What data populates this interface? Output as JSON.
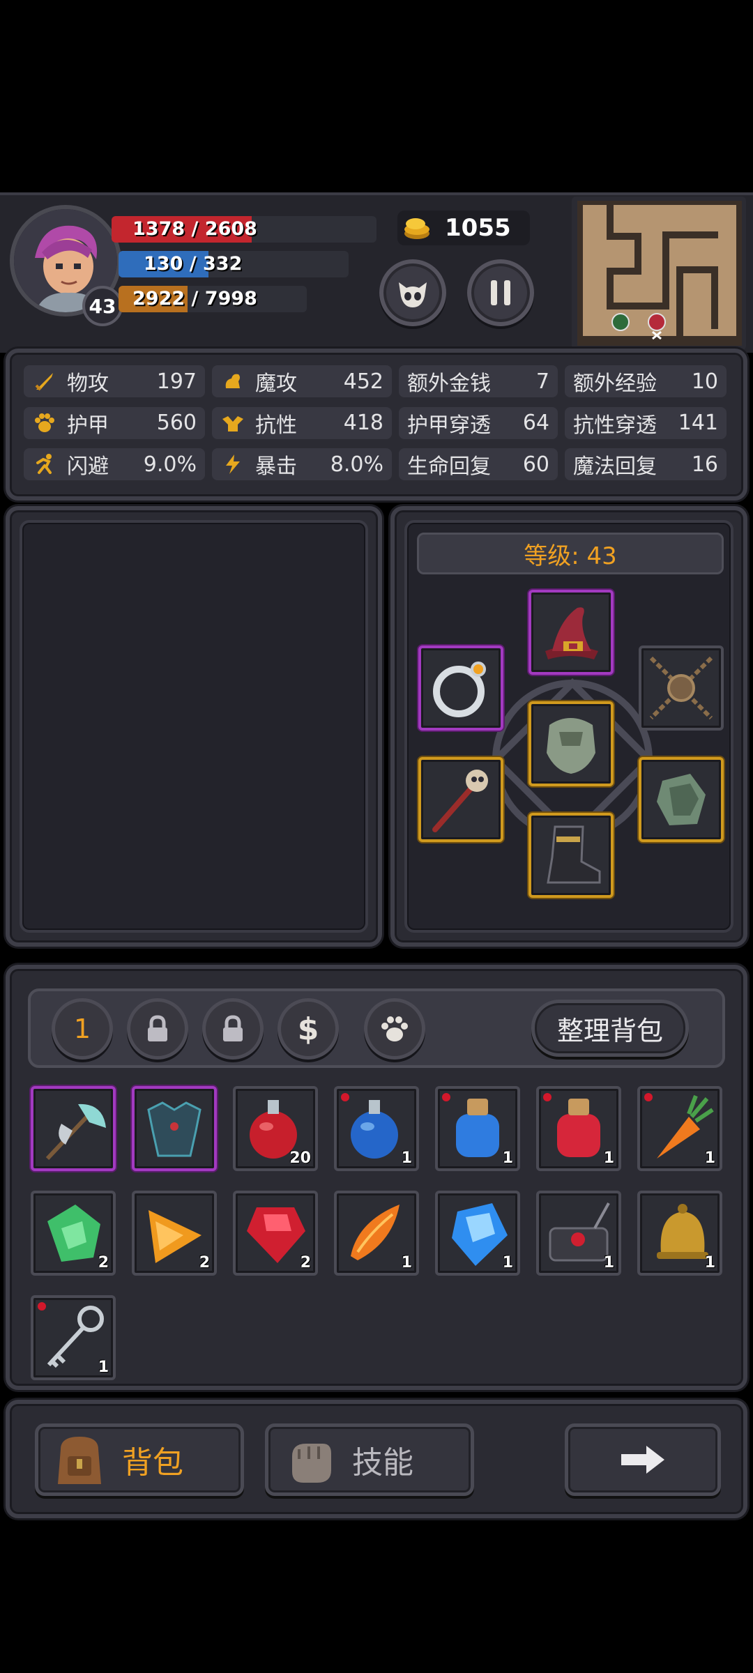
{
  "player": {
    "level": "43",
    "hp": "1378 / 2608",
    "hp_fraction": 0.528,
    "mp": "130 / 332",
    "mp_fraction": 0.39,
    "xp": "2922 / 7998",
    "xp_fraction": 0.366,
    "gold": "1055"
  },
  "stats": [
    {
      "label": "物攻",
      "value": "197",
      "icon": "sword-icon"
    },
    {
      "label": "魔攻",
      "value": "452",
      "icon": "magic-hand-icon"
    },
    {
      "label": "额外金钱",
      "value": "7",
      "icon": ""
    },
    {
      "label": "额外经验",
      "value": "10",
      "icon": ""
    },
    {
      "label": "护甲",
      "value": "560",
      "icon": "paw-shield-icon"
    },
    {
      "label": "抗性",
      "value": "418",
      "icon": "helmet-icon"
    },
    {
      "label": "护甲穿透",
      "value": "64",
      "icon": ""
    },
    {
      "label": "抗性穿透",
      "value": "141",
      "icon": ""
    },
    {
      "label": "闪避",
      "value": "9.0%",
      "icon": "running-icon"
    },
    {
      "label": "暴击",
      "value": "8.0%",
      "icon": "lightning-icon"
    },
    {
      "label": "生命回复",
      "value": "60",
      "icon": ""
    },
    {
      "label": "魔法回复",
      "value": "16",
      "icon": ""
    }
  ],
  "equipment": {
    "level_label": "等级: 43",
    "slots": [
      {
        "name": "wizard-hat",
        "border": "purple"
      },
      {
        "name": "silver-ring",
        "border": "purple"
      },
      {
        "name": "chain-amulet",
        "border": "none"
      },
      {
        "name": "steel-armor",
        "border": "gold"
      },
      {
        "name": "skull-staff",
        "border": "gold"
      },
      {
        "name": "steel-gauntlet",
        "border": "gold"
      },
      {
        "name": "black-boots",
        "border": "gold"
      }
    ]
  },
  "bag": {
    "tabs": [
      "1"
    ],
    "sort_label": "整理背包",
    "items": [
      {
        "name": "battle-axe",
        "count": "",
        "border": "purple",
        "dot": false
      },
      {
        "name": "chest-armor",
        "count": "",
        "border": "purple",
        "dot": false
      },
      {
        "name": "red-potion-round",
        "count": "20",
        "border": "none",
        "dot": false
      },
      {
        "name": "blue-potion-round",
        "count": "1",
        "border": "none",
        "dot": true
      },
      {
        "name": "blue-potion-jar",
        "count": "1",
        "border": "none",
        "dot": true
      },
      {
        "name": "red-potion-jar",
        "count": "1",
        "border": "none",
        "dot": true
      },
      {
        "name": "carrot",
        "count": "1",
        "border": "none",
        "dot": true
      },
      {
        "name": "green-gem",
        "count": "2",
        "border": "none",
        "dot": false
      },
      {
        "name": "orange-gem",
        "count": "2",
        "border": "none",
        "dot": false
      },
      {
        "name": "red-gem",
        "count": "2",
        "border": "none",
        "dot": false
      },
      {
        "name": "flame-leaf",
        "count": "1",
        "border": "none",
        "dot": false
      },
      {
        "name": "blue-gem",
        "count": "1",
        "border": "none",
        "dot": false
      },
      {
        "name": "detonator",
        "count": "1",
        "border": "none",
        "dot": false
      },
      {
        "name": "brass-bell",
        "count": "1",
        "border": "none",
        "dot": false
      },
      {
        "name": "iron-key",
        "count": "1",
        "border": "none",
        "dot": true
      }
    ]
  },
  "bottom": {
    "bag_label": "背包",
    "skills_label": "技能"
  },
  "colors": {
    "hp": "#c3262e",
    "mp": "#2f6dbb",
    "xp": "#b8701f",
    "gold_text": "#f0a122",
    "purple": "#a23ac0",
    "gold_border": "#d09a1e"
  }
}
